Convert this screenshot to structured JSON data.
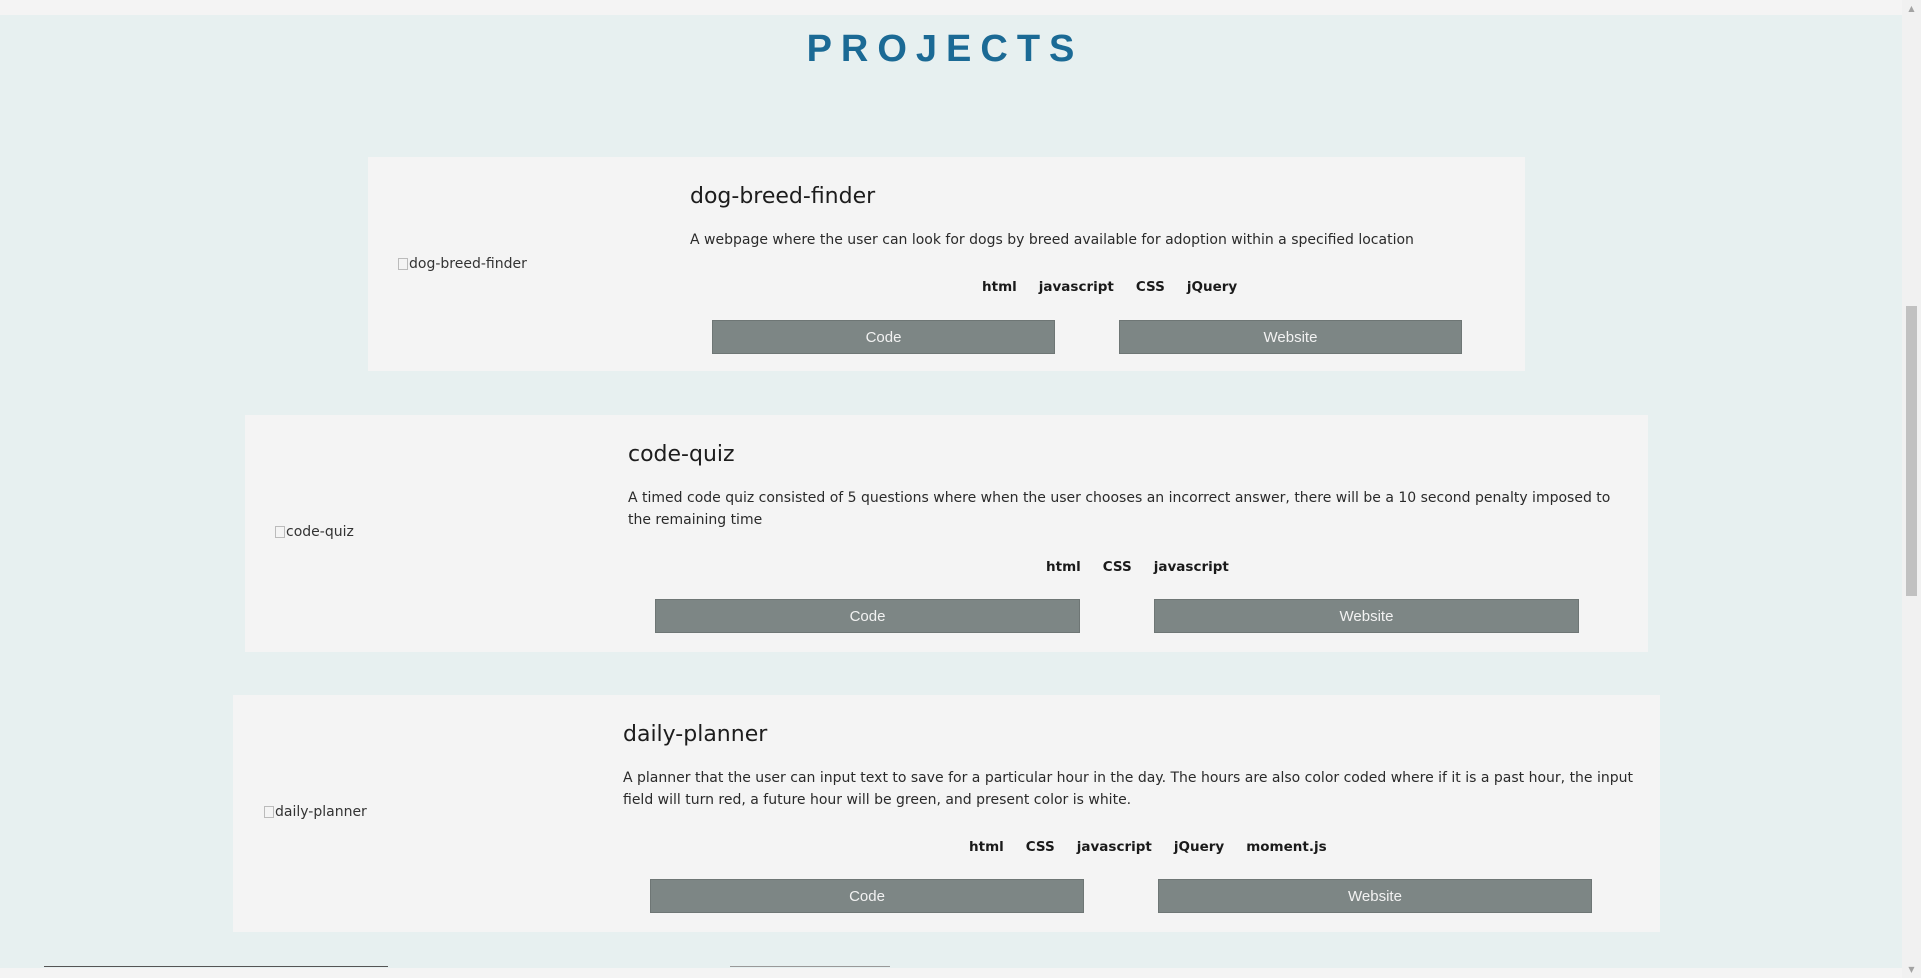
{
  "section_title": "PROJECTS",
  "projects": [
    {
      "title": "dog-breed-finder",
      "image_alt": "dog-breed-finder",
      "description": "A webpage where the user can look for dogs by breed available for adoption within a specified location",
      "tags": [
        "html",
        "javascript",
        "CSS",
        "jQuery"
      ],
      "code_label": "Code",
      "website_label": "Website"
    },
    {
      "title": "code-quiz",
      "image_alt": "code-quiz",
      "description": "A timed code quiz consisted of 5 questions where when the user chooses an incorrect answer, there will be a 10 second penalty imposed to the remaining time",
      "tags": [
        "html",
        "CSS",
        "javascript"
      ],
      "code_label": "Code",
      "website_label": "Website"
    },
    {
      "title": "daily-planner",
      "image_alt": "daily-planner",
      "description": "A planner that the user can input text to save for a particular hour in the day. The hours are also color coded where if it is a past hour, the input field will turn red, a future hour will be green, and present color is white.",
      "tags": [
        "html",
        "CSS",
        "javascript",
        "jQuery",
        "moment.js"
      ],
      "code_label": "Code",
      "website_label": "Website"
    }
  ],
  "scrollbar": {
    "up_icon": "triangle-up",
    "down_icon": "triangle-down"
  }
}
